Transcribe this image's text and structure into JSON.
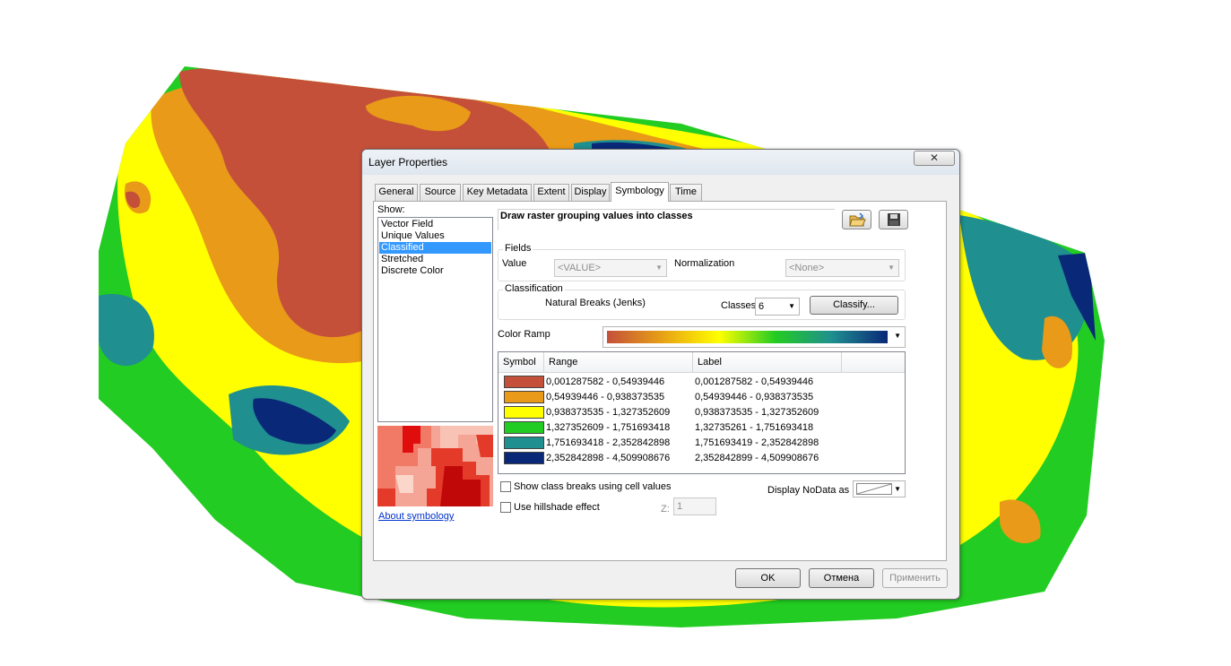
{
  "dialog": {
    "title": "Layer Properties",
    "close_glyph": "✕"
  },
  "tabs": [
    "General",
    "Source",
    "Key Metadata",
    "Extent",
    "Display",
    "Symbology",
    "Time"
  ],
  "active_tab": "Symbology",
  "show": {
    "label": "Show:",
    "items": [
      "Vector Field",
      "Unique Values",
      "Classified",
      "Stretched",
      "Discrete Color"
    ],
    "selected": "Classified"
  },
  "about_link": "About symbology",
  "header": "Draw raster grouping values into classes",
  "fields": {
    "group_title": "Fields",
    "value_label": "Value",
    "value_selected": "<VALUE>",
    "normalization_label": "Normalization",
    "normalization_selected": "<None>"
  },
  "classification": {
    "group_title": "Classification",
    "method": "Natural Breaks (Jenks)",
    "classes_label": "Classes",
    "classes_value": "6",
    "classify_button": "Classify..."
  },
  "color_ramp": {
    "label": "Color Ramp",
    "colors": [
      "#c4503a",
      "#e8a214",
      "#ffff00",
      "#22cc22",
      "#1f8f8f",
      "#0a2878"
    ]
  },
  "table": {
    "headers": [
      "Symbol",
      "Range",
      "Label"
    ],
    "rows": [
      {
        "color": "#c4503a",
        "range": "0,001287582 - 0,54939446",
        "label": "0,001287582 - 0,54939446"
      },
      {
        "color": "#e89a18",
        "range": "0,54939446 - 0,938373535",
        "label": "0,54939446 - 0,938373535"
      },
      {
        "color": "#ffff00",
        "range": "0,938373535 - 1,327352609",
        "label": "0,938373535 - 1,327352609"
      },
      {
        "color": "#22cc22",
        "range": "1,327352609 - 1,751693418",
        "label": "1,32735261 - 1,751693418"
      },
      {
        "color": "#1f8f8f",
        "range": "1,751693418 - 2,352842898",
        "label": "1,751693419 - 2,352842898"
      },
      {
        "color": "#0a2878",
        "range": "2,352842898 - 4,509908676",
        "label": "2,352842899 - 4,509908676"
      }
    ]
  },
  "options": {
    "show_class_breaks": "Show class breaks using cell values",
    "hillshade": "Use hillshade effect",
    "z_label": "Z:",
    "z_value": "1",
    "nodata_label": "Display NoData as"
  },
  "buttons": {
    "ok": "OK",
    "cancel": "Отмена",
    "apply": "Применить"
  }
}
